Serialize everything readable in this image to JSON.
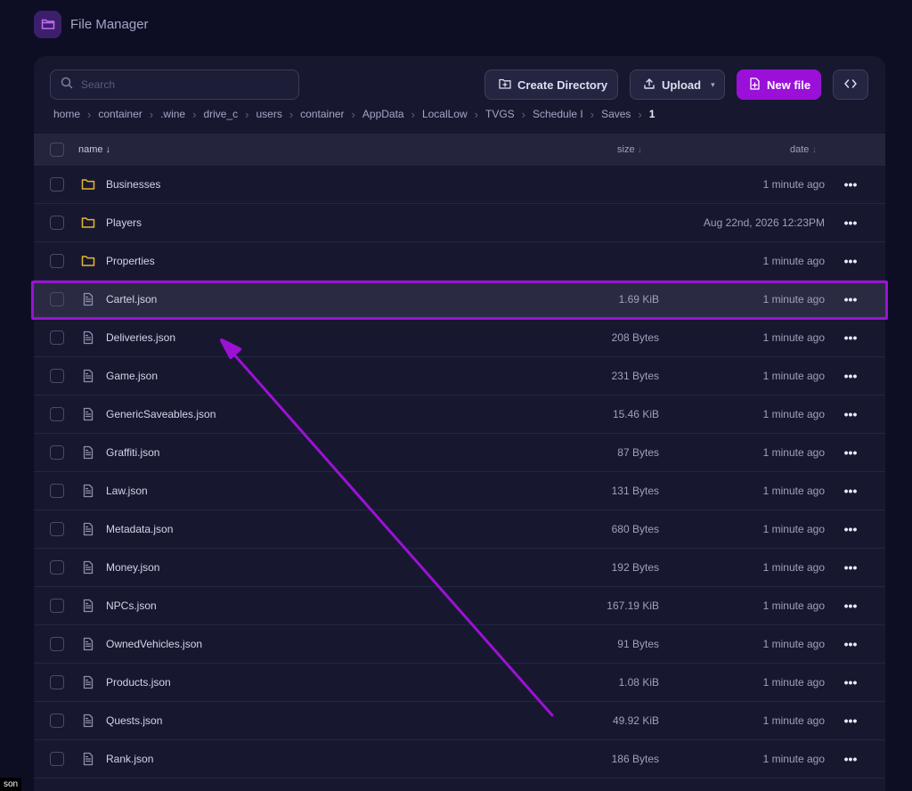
{
  "app": {
    "title": "File Manager",
    "logo_icon": "folder-open-icon"
  },
  "toolbar": {
    "search_placeholder": "Search",
    "create_directory": "Create Directory",
    "upload": "Upload",
    "new_file": "New file",
    "code_toggle_icon": "code-brackets-icon"
  },
  "breadcrumb": {
    "items": [
      "home",
      "container",
      ".wine",
      "drive_c",
      "users",
      "container",
      "AppData",
      "LocalLow",
      "TVGS",
      "Schedule I",
      "Saves"
    ],
    "current": "1"
  },
  "table": {
    "headers": {
      "name": "name",
      "size": "size",
      "date": "date"
    },
    "sort_arrow": "↓",
    "rows": [
      {
        "type": "folder",
        "name": "Businesses",
        "size": "",
        "date": "1 minute ago"
      },
      {
        "type": "folder",
        "name": "Players",
        "size": "",
        "date": "Aug 22nd, 2026 12:23PM"
      },
      {
        "type": "folder",
        "name": "Properties",
        "size": "",
        "date": "1 minute ago"
      },
      {
        "type": "file",
        "name": "Cartel.json",
        "size": "1.69 KiB",
        "date": "1 minute ago"
      },
      {
        "type": "file",
        "name": "Deliveries.json",
        "size": "208 Bytes",
        "date": "1 minute ago"
      },
      {
        "type": "file",
        "name": "Game.json",
        "size": "231 Bytes",
        "date": "1 minute ago"
      },
      {
        "type": "file",
        "name": "GenericSaveables.json",
        "size": "15.46 KiB",
        "date": "1 minute ago"
      },
      {
        "type": "file",
        "name": "Graffiti.json",
        "size": "87 Bytes",
        "date": "1 minute ago"
      },
      {
        "type": "file",
        "name": "Law.json",
        "size": "131 Bytes",
        "date": "1 minute ago"
      },
      {
        "type": "file",
        "name": "Metadata.json",
        "size": "680 Bytes",
        "date": "1 minute ago"
      },
      {
        "type": "file",
        "name": "Money.json",
        "size": "192 Bytes",
        "date": "1 minute ago"
      },
      {
        "type": "file",
        "name": "NPCs.json",
        "size": "167.19 KiB",
        "date": "1 minute ago"
      },
      {
        "type": "file",
        "name": "OwnedVehicles.json",
        "size": "91 Bytes",
        "date": "1 minute ago"
      },
      {
        "type": "file",
        "name": "Products.json",
        "size": "1.08 KiB",
        "date": "1 minute ago"
      },
      {
        "type": "file",
        "name": "Quests.json",
        "size": "49.92 KiB",
        "date": "1 minute ago"
      },
      {
        "type": "file",
        "name": "Rank.json",
        "size": "186 Bytes",
        "date": "1 minute ago"
      }
    ],
    "highlighted_row": "Cartel.json"
  },
  "tooltip": "son",
  "colors": {
    "accent": "#9a10d8",
    "annotation": "#9b12d4",
    "folder": "#e6b62f",
    "background": "#0d0e24",
    "panel": "#171830"
  }
}
